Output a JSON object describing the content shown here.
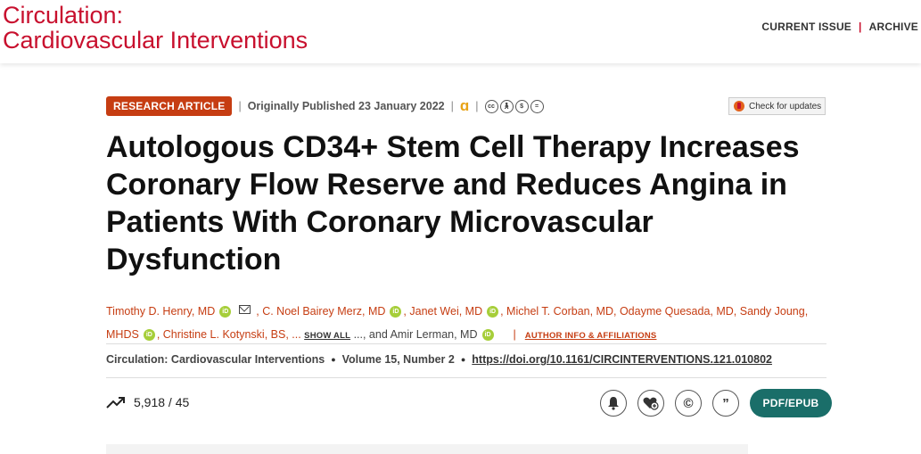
{
  "brand": {
    "line1": "Circulation:",
    "line2": "Cardiovascular Interventions"
  },
  "nav": {
    "current_issue": "CURRENT ISSUE",
    "separator": "|",
    "archive": "ARCHIVE"
  },
  "meta": {
    "article_type": "RESEARCH ARTICLE",
    "published": "Originally Published 23 January 2022",
    "open_access_icon": "open-access-icon",
    "license_icons": [
      "cc-icon",
      "by-icon",
      "nc-icon",
      "nd-icon"
    ],
    "check_updates": "Check for updates"
  },
  "title": "Autologous CD34+ Stem Cell Therapy Increases Coronary Flow Reserve and Reduces Angina in Patients With Coronary Microvascular Dysfunction",
  "authors": {
    "a1": "Timothy D. Henry, MD",
    "a2": ", C. Noel Bairey Merz, MD",
    "a3": ", Janet Wei, MD",
    "a4": ", Michel T. Corban, MD, Odayme Quesada, MD, Sandy Joung,",
    "a5": "MHDS",
    "a6": ", Christine L. Kotynski, BS, ...",
    "show_all": "SHOW ALL",
    "a7": " ..., and Amir Lerman, MD",
    "author_info": "AUTHOR INFO & AFFILIATIONS"
  },
  "citation": {
    "journal": "Circulation: Cardiovascular Interventions",
    "volume": "Volume 15, Number 2",
    "doi": "https://doi.org/10.1161/CIRCINTERVENTIONS.121.010802"
  },
  "metrics": {
    "value": "5,918 / 45"
  },
  "actions": {
    "pdf": "PDF/EPUB"
  },
  "colors": {
    "brand_red": "#c8102e",
    "badge": "#c63d12",
    "pdf_button": "#1a6e69",
    "orcid": "#a6ce39"
  }
}
